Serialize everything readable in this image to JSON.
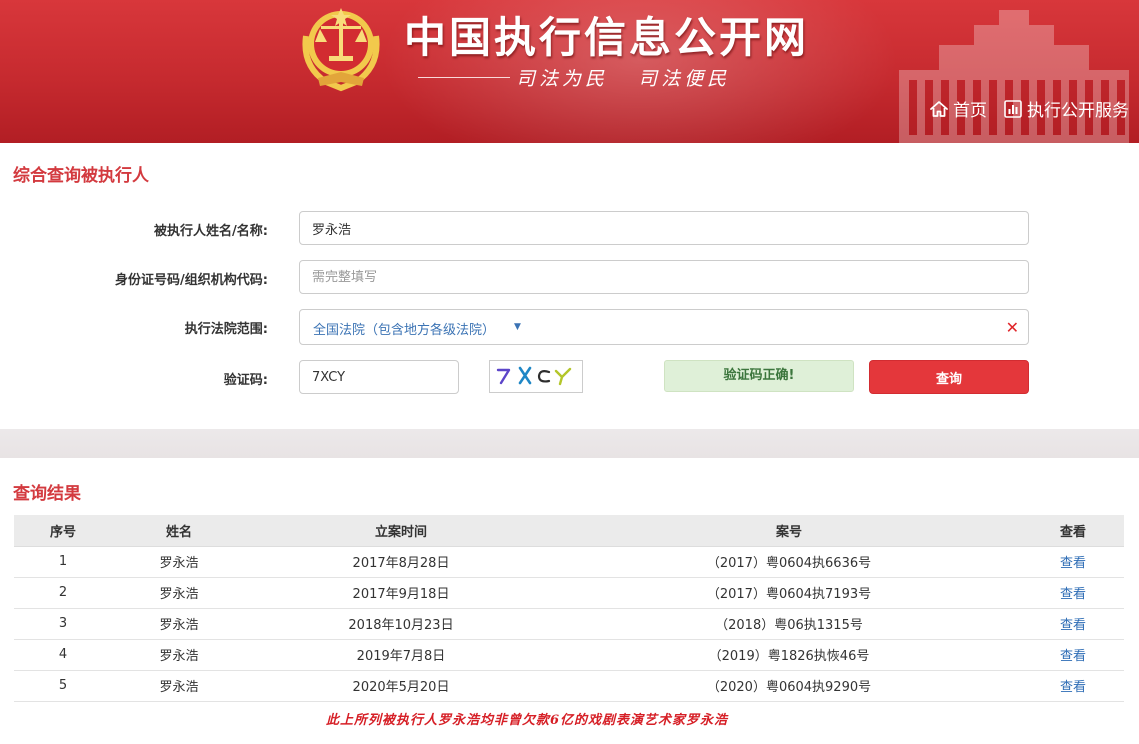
{
  "header": {
    "site_title": "中国执行信息公开网",
    "slogan": "司法为民   司法便民",
    "nav": [
      {
        "label": "首页",
        "icon": "home-icon"
      },
      {
        "label": "执行公开服务",
        "icon": "bar-chart-icon"
      }
    ],
    "accent_color": "#c62a2f"
  },
  "search": {
    "title": "综合查询被执行人",
    "name_label": "被执行人姓名/名称:",
    "name_value": "罗永浩",
    "id_label": "身份证号码/组织机构代码:",
    "id_placeholder": "需完整填写",
    "court_label": "执行法院范围:",
    "court_value": "全国法院（包含地方各级法院）",
    "captcha_label": "验证码:",
    "captcha_value": "7XCY",
    "captcha_status": "验证码正确!",
    "query_button": "查询"
  },
  "results": {
    "title": "查询结果",
    "columns": [
      "序号",
      "姓名",
      "立案时间",
      "案号",
      "查看"
    ],
    "rows": [
      [
        "1",
        "罗永浩",
        "2017年8月28日",
        "（2017）粤0604执6636号",
        "查看"
      ],
      [
        "2",
        "罗永浩",
        "2017年9月18日",
        "（2017）粤0604执7193号",
        "查看"
      ],
      [
        "3",
        "罗永浩",
        "2018年10月23日",
        "（2018）粤06执1315号",
        "查看"
      ],
      [
        "4",
        "罗永浩",
        "2019年7月8日",
        "（2019）粤1826执恢46号",
        "查看"
      ],
      [
        "5",
        "罗永浩",
        "2020年5月20日",
        "（2020）粤0604执9290号",
        "查看"
      ]
    ]
  },
  "footnote": "此上所列被执行人罗永浩均非曾欠款6亿的戏剧表演艺术家罗永浩"
}
